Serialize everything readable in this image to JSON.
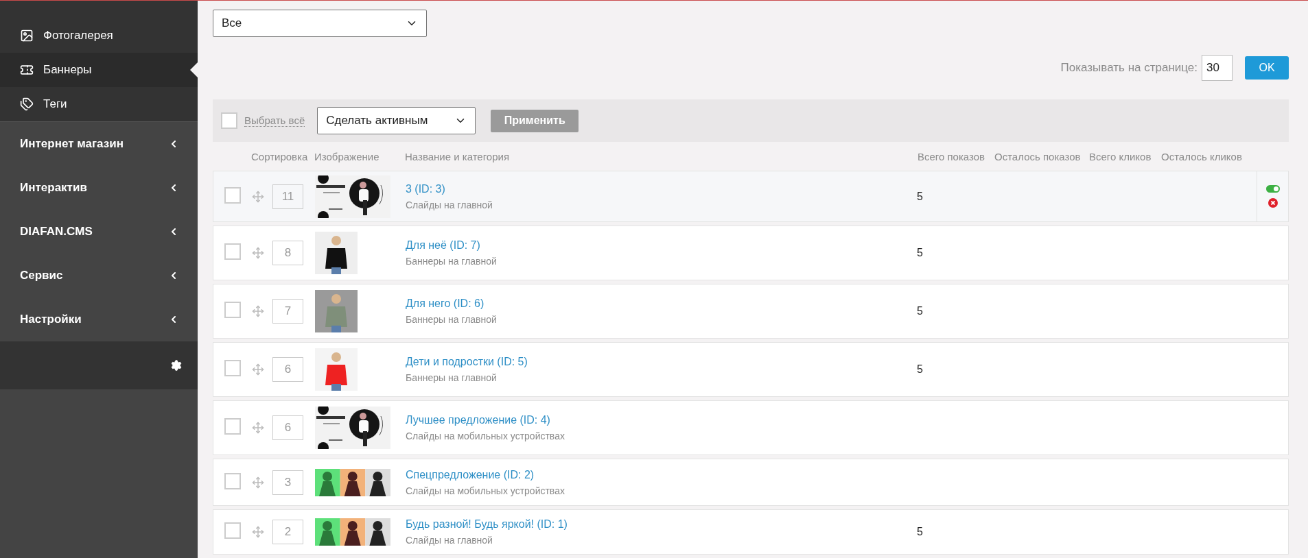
{
  "sidebar": {
    "items": [
      {
        "label": "Фотогалерея",
        "selected": false
      },
      {
        "label": "Баннеры",
        "selected": true
      },
      {
        "label": "Теги",
        "selected": false
      }
    ],
    "groups": [
      {
        "label": "Интернет магазин",
        "expanded": false
      },
      {
        "label": "Интерактив",
        "expanded": false
      },
      {
        "label": "DIAFAN.CMS",
        "expanded": false
      },
      {
        "label": "Сервис",
        "expanded": false
      },
      {
        "label": "Настройки",
        "expanded": false
      }
    ]
  },
  "filter": {
    "value": "Все"
  },
  "per_page": {
    "label": "Показывать на странице:",
    "value": "30",
    "button": "OK"
  },
  "bulk": {
    "select_all_checked": false,
    "select_all_label": "Выбрать всё",
    "action": "Сделать активным",
    "apply": "Применить"
  },
  "table": {
    "columns": [
      "Сортировка",
      "Изображение",
      "Название и категория",
      "Всего показов",
      "Осталось показов",
      "Всего кликов",
      "Осталось кликов"
    ],
    "rows": [
      {
        "checked": false,
        "sort": "11",
        "name": "3 (ID: 3)",
        "category": "Слайды на главной",
        "views": "5",
        "hovered": true,
        "active": true
      },
      {
        "checked": false,
        "sort": "8",
        "name": "Для неё (ID: 7)",
        "category": "Баннеры на главной",
        "views": "5",
        "hovered": false
      },
      {
        "checked": false,
        "sort": "7",
        "name": "Для него (ID: 6)",
        "category": "Баннеры на главной",
        "views": "5",
        "hovered": false
      },
      {
        "checked": false,
        "sort": "6",
        "name": "Дети и подростки (ID: 5)",
        "category": "Баннеры на главной",
        "views": "5",
        "hovered": false
      },
      {
        "checked": false,
        "sort": "6",
        "name": "Лучшее предложение (ID: 4)",
        "category": "Слайды на мобильных устройствах",
        "hovered": false
      },
      {
        "checked": false,
        "sort": "3",
        "name": "Спецпредложение (ID: 2)",
        "category": "Слайды на мобильных устройствах",
        "hovered": false
      },
      {
        "checked": false,
        "sort": "2",
        "name": "Будь разной! Будь яркой! (ID: 1)",
        "category": "Слайды на главной",
        "views": "5",
        "hovered": false
      }
    ]
  }
}
